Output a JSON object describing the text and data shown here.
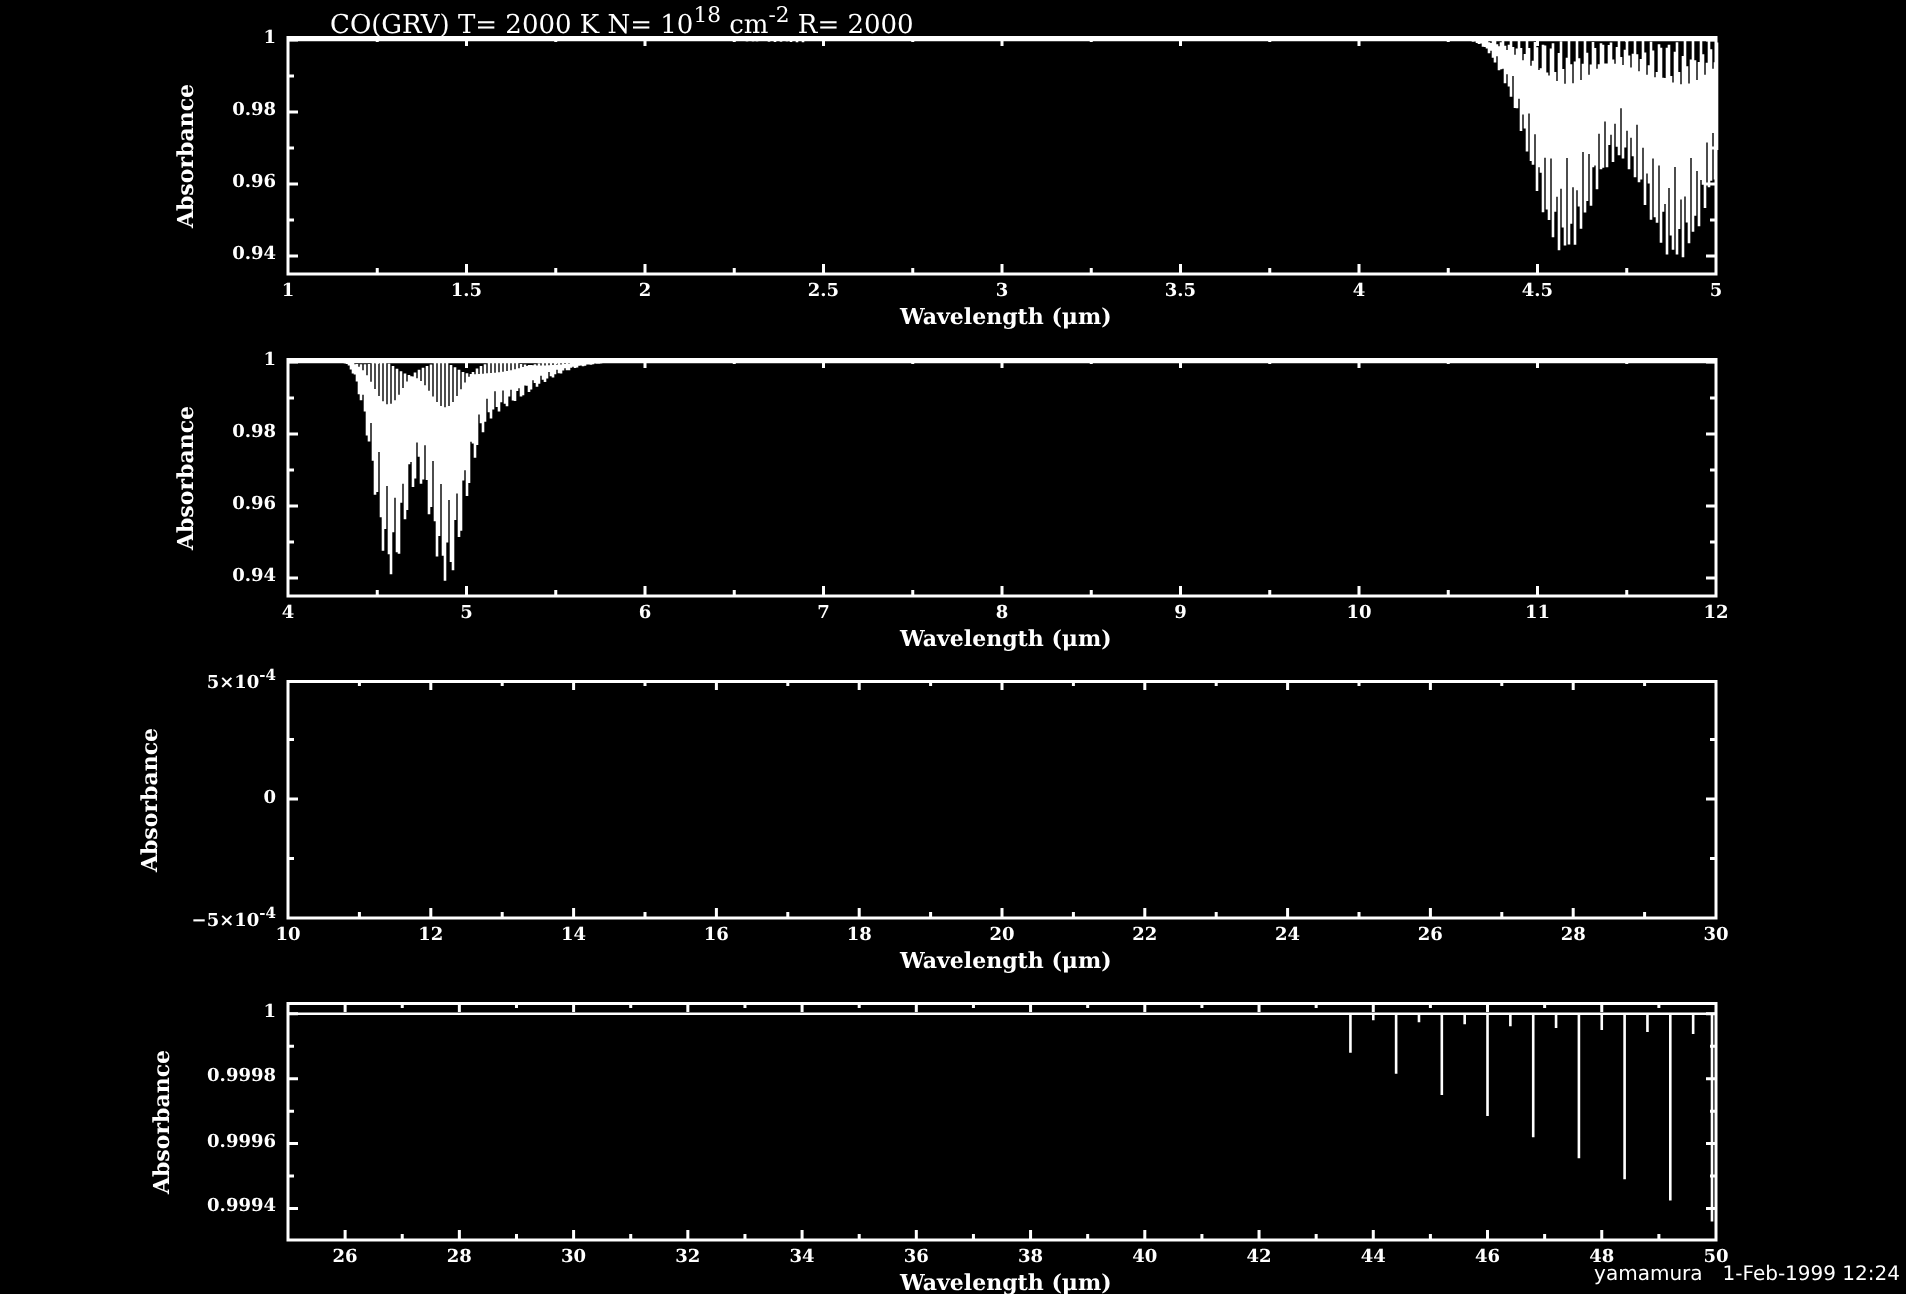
{
  "title": "CO(GRV) T= 2000 K N= 10$^{18}$ cm$^{-2}$ R= 2000",
  "panels": [
    {
      "kind": "band",
      "ylabel": "Absorbance",
      "xlabel": "Wavelength (μm)",
      "xticks": [
        "1",
        "1.5",
        "2",
        "2.5",
        "3",
        "3.5",
        "4",
        "4.5",
        "5"
      ],
      "yticks": [
        "1",
        "0.98",
        "0.96",
        "0.94"
      ]
    },
    {
      "kind": "band",
      "ylabel": "Absorbance",
      "xlabel": "Wavelength (μm)",
      "xticks": [
        "4",
        "5",
        "6",
        "7",
        "8",
        "9",
        "10",
        "11",
        "12"
      ],
      "yticks": [
        "1",
        "0.98",
        "0.96",
        "0.94"
      ]
    },
    {
      "kind": "flat",
      "ylabel": "Absorbance",
      "xlabel": "Wavelength (μm)",
      "xticks": [
        "10",
        "12",
        "14",
        "16",
        "18",
        "20",
        "22",
        "24",
        "26",
        "28",
        "30"
      ],
      "yticks": [
        "5×10$^{-4}$",
        "0",
        "−5×10$^{-4}$"
      ]
    },
    {
      "kind": "lines",
      "ylabel": "Absorbance",
      "xlabel": "Wavelength (μm)",
      "xticks": [
        "26",
        "28",
        "30",
        "32",
        "34",
        "36",
        "38",
        "40",
        "42",
        "44",
        "46",
        "48",
        "50"
      ],
      "yticks": [
        "1",
        "0.9998",
        "0.9996",
        "0.9994"
      ]
    }
  ],
  "footer": {
    "author": "yamamura",
    "timestamp": "1-Feb-1999 12:24"
  }
}
